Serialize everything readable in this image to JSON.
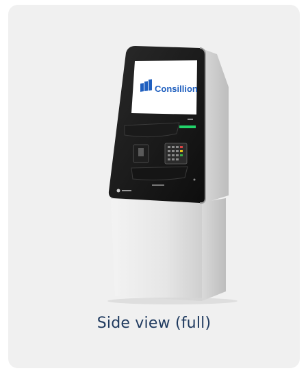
{
  "caption": "Side view (full)",
  "brand": {
    "logo_text": "Consillion",
    "color": "#1f5fbf"
  },
  "colors": {
    "card_bg": "#f0f0f0",
    "caption": "#1f3a5f",
    "indicator": "#22d36a"
  },
  "icons": [
    "consillion-logo-icon",
    "card-reader-slot",
    "pin-pad-icon"
  ]
}
